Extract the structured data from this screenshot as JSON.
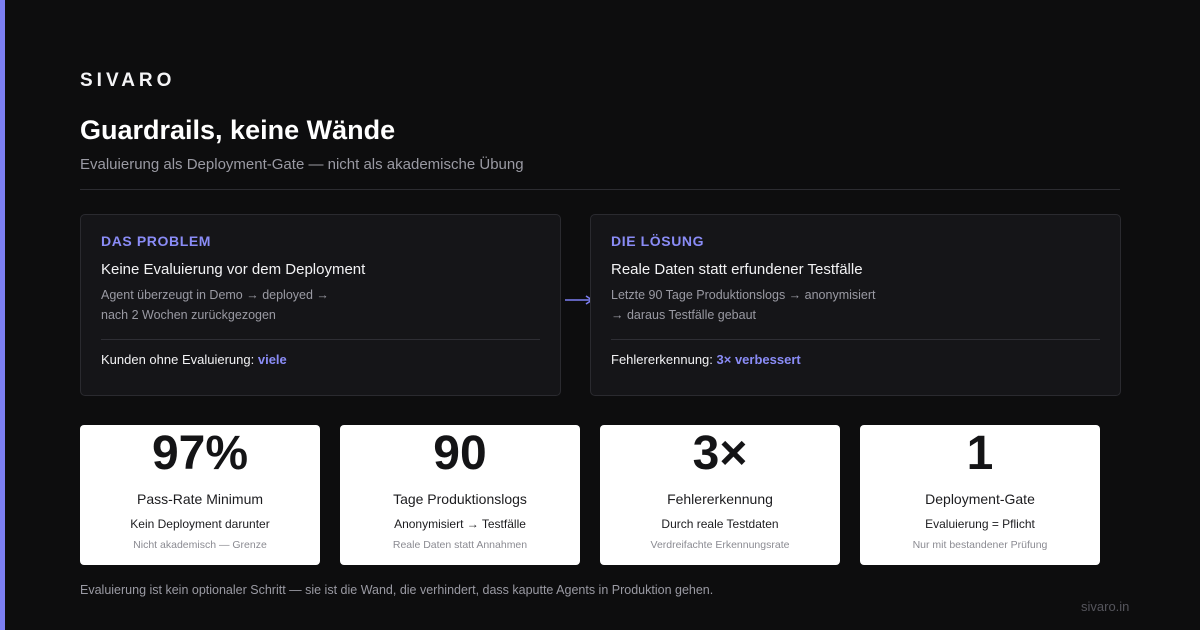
{
  "brand": "SIVARO",
  "title": "Guardrails, keine Wände",
  "subtitle": "Evaluierung als Deployment-Gate — nicht als akademische Übung",
  "panels": {
    "problem": {
      "label": "DAS PROBLEM",
      "heading": "Keine Evaluierung vor dem Deployment",
      "body_line1": "Agent überzeugt in Demo → deployed →",
      "body_line2": "nach 2 Wochen zurückgezogen",
      "metric_label": "Kunden ohne Evaluierung: ",
      "metric_value": "viele"
    },
    "solution": {
      "label": "DIE LÖSUNG",
      "heading": "Reale Daten statt erfundener Testfälle",
      "body_line1": "Letzte 90 Tage Produktionslogs → anonymisiert",
      "body_line2": "→ daraus Testfälle gebaut",
      "metric_label": "Fehlererkennung: ",
      "metric_value": "3× verbessert"
    }
  },
  "cards": [
    {
      "value": "97%",
      "label": "Pass-Rate Minimum",
      "sub": "Kein Deployment darunter",
      "note": "Nicht akademisch — Grenze"
    },
    {
      "value": "90",
      "label": "Tage Produktionslogs",
      "sub": "Anonymisiert → Testfälle",
      "note": "Reale Daten statt Annahmen"
    },
    {
      "value": "3×",
      "label": "Fehlererkennung",
      "sub": "Durch reale Testdaten",
      "note": "Verdreifachte Erkennungsrate"
    },
    {
      "value": "1",
      "label": "Deployment-Gate",
      "sub": "Evaluierung = Pflicht",
      "note": "Nur mit bestandener Prüfung"
    }
  ],
  "footer": "Evaluierung ist kein optionaler Schritt — sie ist die Wand, die verhindert, dass kaputte Agents in Produktion gehen.",
  "site": "sivaro.in",
  "colors": {
    "accent": "#7c7ff2",
    "background": "#0d0d0e",
    "panel": "#151518",
    "card": "#ffffff"
  },
  "icons": {
    "arrow": "arrow-right-icon"
  }
}
